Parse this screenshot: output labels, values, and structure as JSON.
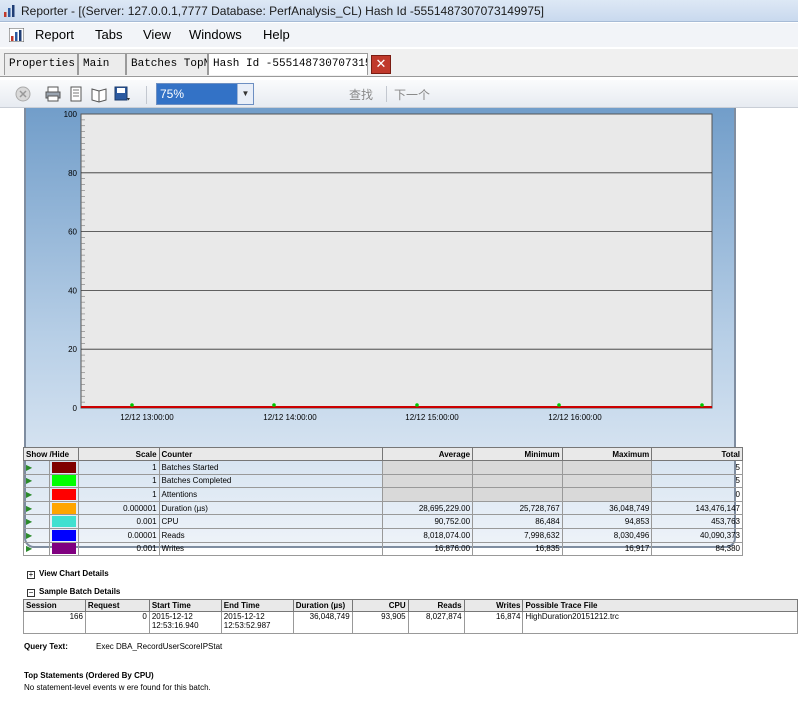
{
  "window": {
    "title": "Reporter - [(Server: 127.0.0.1,7777 Database: PerfAnalysis_CL) Hash Id -5551487307073149975]"
  },
  "menu": [
    "Report",
    "Tabs",
    "View",
    "Windows",
    "Help"
  ],
  "tabs": [
    "Properties",
    "Main",
    "Batches TopN",
    "Hash Id -555148730707315..."
  ],
  "toolbar": {
    "zoom": "75%",
    "find": "查找",
    "next": "下一个"
  },
  "chart_data": {
    "type": "line",
    "y_ticks": [
      "0",
      "20",
      "40",
      "60",
      "80",
      "100"
    ],
    "ylim": [
      0,
      100
    ],
    "x_ticks": [
      "12/12 13:00:00",
      "12/12 14:00:00",
      "12/12 15:00:00",
      "12/12 16:00:00"
    ],
    "grid": true,
    "background": "#e9e9e9"
  },
  "counters": {
    "headers": {
      "show": "Show /Hide",
      "scale": "Scale",
      "counter": "Counter",
      "average": "Average",
      "minimum": "Minimum",
      "maximum": "Maximum",
      "total": "Total"
    },
    "rows": [
      {
        "color": "#800000",
        "scale": "1",
        "counter": "Batches Started",
        "average": "",
        "minimum": "",
        "maximum": "",
        "total": "5"
      },
      {
        "color": "#00ff00",
        "scale": "1",
        "counter": "Batches Completed",
        "average": "",
        "minimum": "",
        "maximum": "",
        "total": "5"
      },
      {
        "color": "#ff0000",
        "scale": "1",
        "counter": "Attentions",
        "average": "",
        "minimum": "",
        "maximum": "",
        "total": "0"
      },
      {
        "color": "#ffa500",
        "scale": "0.000001",
        "counter": "Duration (µs)",
        "average": "28,695,229.00",
        "minimum": "25,728,767",
        "maximum": "36,048,749",
        "total": "143,476,147"
      },
      {
        "color": "#40e0d0",
        "scale": "0.001",
        "counter": "CPU",
        "average": "90,752.00",
        "minimum": "86,484",
        "maximum": "94,853",
        "total": "453,763"
      },
      {
        "color": "#0000ff",
        "scale": "0.00001",
        "counter": "Reads",
        "average": "8,018,074.00",
        "minimum": "7,998,632",
        "maximum": "8,030,496",
        "total": "40,090,373"
      },
      {
        "color": "#800080",
        "scale": "0.001",
        "counter": "Writes",
        "average": "16,876.00",
        "minimum": "16,835",
        "maximum": "16,917",
        "total": "84,380"
      }
    ]
  },
  "view_chart_details": "View Chart Details",
  "sample_batch_details": "Sample Batch Details",
  "batch": {
    "headers": {
      "session": "Session",
      "request": "Request",
      "start": "Start Time",
      "end": "End Time",
      "duration": "Duration (µs)",
      "cpu": "CPU",
      "reads": "Reads",
      "writes": "Writes",
      "trace": "Possible Trace File"
    },
    "row": {
      "session": "166",
      "request": "0",
      "start_date": "2015-12-12",
      "start_time": "12:53:16.940",
      "end_date": "2015-12-12",
      "end_time": "12:53:52.987",
      "duration": "36,048,749",
      "cpu": "93,905",
      "reads": "8,027,874",
      "writes": "16,874",
      "trace": "HighDuration20151212.trc"
    }
  },
  "query_text": {
    "label": "Query Text:",
    "value": "Exec DBA_RecordUserScoreIPStat"
  },
  "top_statements": {
    "title": "Top Statements (Ordered By CPU)",
    "note": "No statement-level events w ere found for this batch."
  }
}
